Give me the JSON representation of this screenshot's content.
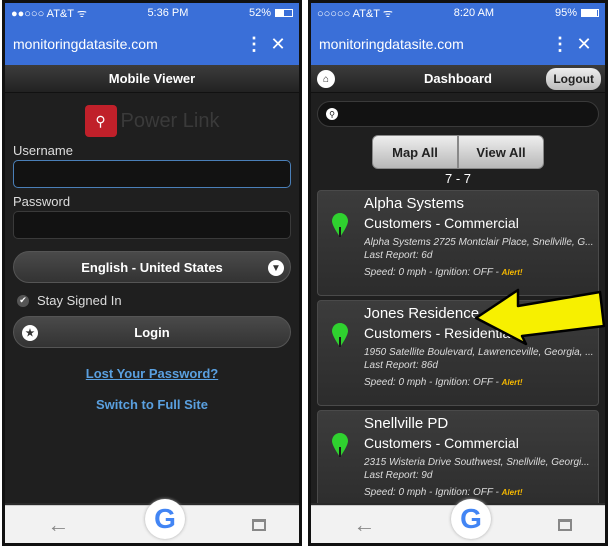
{
  "left": {
    "status": {
      "carrier": "●●○○○ AT&T ᯤ",
      "time": "5:36 PM",
      "battery": "52%",
      "battery_level": 0.52
    },
    "browser": {
      "url": "monitoringdatasite.com",
      "menu": "⋮",
      "close": "✕"
    },
    "title": "Mobile Viewer",
    "logo_text": "Power Link",
    "username_label": "Username",
    "password_label": "Password",
    "language": "English - United States",
    "stay_signed_in": "Stay Signed In",
    "login_label": "Login",
    "lost_password": "Lost Your Password?",
    "full_site": "Switch to Full Site"
  },
  "right": {
    "status": {
      "carrier": "○○○○○ AT&T ᯤ",
      "time": "8:20 AM",
      "battery": "95%",
      "battery_level": 0.95
    },
    "browser": {
      "url": "monitoringdatasite.com",
      "menu": "⋮",
      "close": "✕"
    },
    "title": "Dashboard",
    "logout": "Logout",
    "map_all": "Map All",
    "view_all": "View All",
    "count": "7 - 7",
    "items": [
      {
        "name": "Alpha Systems",
        "category": "Customers - Commercial",
        "address": "Alpha Systems 2725 Montclair Place, Snellville, G...",
        "report": "Last Report: 6d",
        "speed": "Speed: 0 mph - Ignition: OFF - ",
        "alert": "Alert!"
      },
      {
        "name": "Jones Residence",
        "category": "Customers - Residential",
        "address": "1950 Satellite Boulevard, Lawrenceville, Georgia, ...",
        "report": "Last Report: 86d",
        "speed": "Speed: 0 mph - Ignition: OFF - ",
        "alert": "Alert!"
      },
      {
        "name": "Snellville PD",
        "category": "Customers - Commercial",
        "address": "2315 Wisteria Drive Southwest, Snellville, Georgi...",
        "report": "Last Report: 9d",
        "speed": "Speed: 0 mph - Ignition: OFF - ",
        "alert": "Alert!"
      }
    ]
  },
  "colors": {
    "browser_bar": "#3a6fd8",
    "pin_green": "#2fd12f",
    "arrow_yellow": "#f7f000",
    "link_blue": "#5aa0e0",
    "alert_orange": "#f5b800"
  },
  "icons": [
    "home-icon",
    "search-icon",
    "map-pin-icon",
    "chevron-down-icon",
    "star-icon",
    "back-arrow-icon",
    "google-icon",
    "tabs-icon"
  ]
}
